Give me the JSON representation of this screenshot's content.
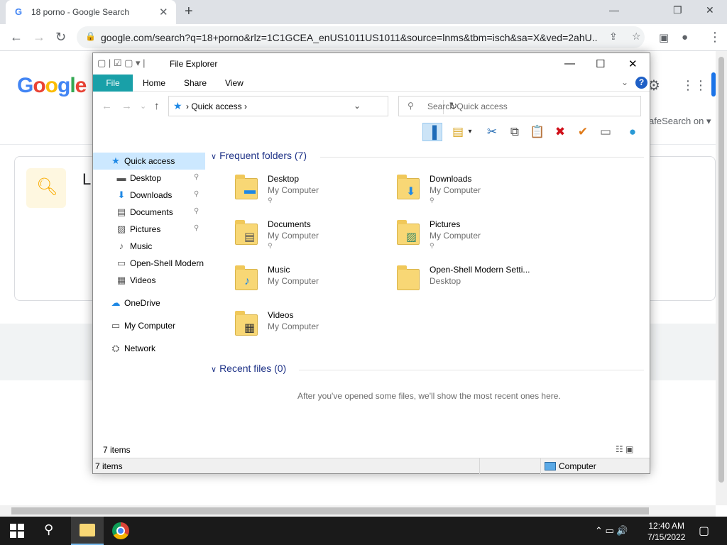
{
  "browser": {
    "tab_title": "18 porno - Google Search",
    "tab_favicon": "G",
    "tab_close": "✕",
    "new_tab": "+",
    "win_min": "—",
    "win_restore": "❐",
    "win_close": "✕",
    "back": "←",
    "forward": "→",
    "reload": "↻",
    "url": "google.com/search?q=18+porno&rlz=1C1GCEA_enUS1011US1011&source=lnms&tbm=isch&sa=X&ved=2ahU...",
    "share_icon": "⇪",
    "star_icon": "☆",
    "sidepanel_icon": "▣",
    "profile_icon": "●",
    "menu_icon": "⋮"
  },
  "google": {
    "logo": [
      "G",
      "o",
      "o",
      "g",
      "l",
      "e"
    ],
    "logo_colors": [
      "#4285f4",
      "#ea4335",
      "#fbbc05",
      "#4285f4",
      "#34a853",
      "#ea4335"
    ],
    "safesearch": "afeSearch on ▾",
    "card_letter": "L"
  },
  "explorer": {
    "title": "File Explorer",
    "qat": "▢ | ☑ ▢ ▾ |",
    "min": "—",
    "max": "☐",
    "close": "✕",
    "ribbon_tabs": [
      "File",
      "Home",
      "Share",
      "View"
    ],
    "help": "?",
    "ribbon_chevron": "⌄",
    "nav_back": "←",
    "nav_forward": "→",
    "nav_up_recent": "⌄",
    "nav_up": "↑",
    "address_crumb": "›   Quick access   ›",
    "address_dropdown": "⌄",
    "refresh": "↻",
    "search_placeholder": "Search Quick access",
    "toolbar_icons": [
      "▐",
      "▤",
      "▾",
      "✂",
      "⧉",
      "📋",
      "✖",
      "✔",
      "▭",
      "●"
    ],
    "nav_items": [
      {
        "label": "Quick access",
        "icon": "★",
        "pinned": false,
        "selected": true,
        "top": true
      },
      {
        "label": "Desktop",
        "icon": "▬",
        "pinned": true
      },
      {
        "label": "Downloads",
        "icon": "⬇",
        "pinned": true
      },
      {
        "label": "Documents",
        "icon": "▤",
        "pinned": true
      },
      {
        "label": "Pictures",
        "icon": "▨",
        "pinned": true
      },
      {
        "label": "Music",
        "icon": "♪",
        "pinned": false
      },
      {
        "label": "Open-Shell Modern",
        "icon": "▭",
        "pinned": false
      },
      {
        "label": "Videos",
        "icon": "▦",
        "pinned": false
      },
      {
        "label": "OneDrive",
        "icon": "☁",
        "pinned": false,
        "top": true
      },
      {
        "label": "My Computer",
        "icon": "▭",
        "pinned": false,
        "top": true
      },
      {
        "label": "Network",
        "icon": "⛭",
        "pinned": false,
        "top": true
      }
    ],
    "pin_glyph": "📌",
    "frequent_header": "Frequent folders (7)",
    "recent_header": "Recent files (0)",
    "folders": [
      {
        "name": "Desktop",
        "sub": "My Computer",
        "pinned": true,
        "overlay": "▬",
        "overlay_color": "#1e88e5"
      },
      {
        "name": "Downloads",
        "sub": "My Computer",
        "pinned": true,
        "overlay": "⬇",
        "overlay_color": "#1e88e5"
      },
      {
        "name": "Documents",
        "sub": "My Computer",
        "pinned": true,
        "overlay": "▤",
        "overlay_color": "#555"
      },
      {
        "name": "Pictures",
        "sub": "My Computer",
        "pinned": true,
        "overlay": "▨",
        "overlay_color": "#3a8a6a"
      },
      {
        "name": "Music",
        "sub": "My Computer",
        "pinned": false,
        "overlay": "♪",
        "overlay_color": "#1e88e5"
      },
      {
        "name": "Open-Shell Modern Setti...",
        "sub": "Desktop",
        "pinned": false,
        "overlay": "",
        "overlay_color": "#000"
      },
      {
        "name": "Videos",
        "sub": "My Computer",
        "pinned": false,
        "overlay": "▦",
        "overlay_color": "#333"
      }
    ],
    "recent_empty": "After you've opened some files, we'll show the most recent ones here.",
    "status_items": "7 items",
    "view_icons": "☷ ▣",
    "bottom_items": "7 items",
    "bottom_computer": "Computer"
  },
  "taskbar": {
    "search_icon": "⚲",
    "tray": "⌃  ▭  🔊",
    "time": "12:40 AM",
    "date": "7/15/2022",
    "notifications": "▢"
  },
  "scroll": {
    "up": "▲",
    "down": "▼",
    "left": "◀",
    "right": "▶"
  }
}
